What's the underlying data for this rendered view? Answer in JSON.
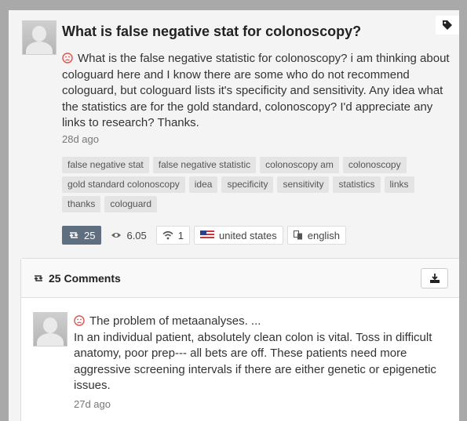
{
  "post": {
    "title": "What is false negative stat for colonoscopy?",
    "body": "What is the false negative statistic for colonoscopy?  i am thinking about cologuard here and I know there are some who do not recommend cologuard, but cologuard lists it's specificity and sensitivity.  Any idea what the statistics are for the gold standard, colonoscopy?  I'd appreciate any links to research? Thanks.",
    "time": "28d ago",
    "tags": [
      "false negative stat",
      "false negative statistic",
      "colonoscopy am",
      "colonoscopy",
      "gold standard colonoscopy",
      "idea",
      "specificity",
      "sensitivity",
      "statistics",
      "links",
      "thanks",
      "cologuard"
    ],
    "stats": {
      "replies": "25",
      "views": "6.05",
      "signal": "1",
      "country": "united states",
      "language": "english"
    }
  },
  "comments": {
    "header": "25 Comments",
    "items": [
      {
        "title": "The problem of metaanalyses. ...",
        "body": "In an individual patient, absolutely clean colon is vital. Toss in difficult anatomy, poor prep--- all bets are off. These patients need more aggressive screening intervals if there are either genetic or epigenetic issues.",
        "time": "27d ago"
      }
    ]
  },
  "colors": {
    "accent": "#d9534f",
    "stat_dark": "#5f6f80"
  }
}
